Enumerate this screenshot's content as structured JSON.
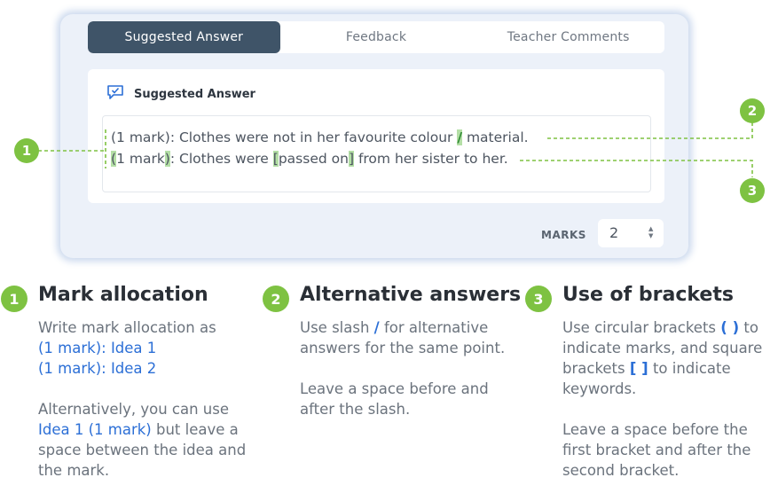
{
  "tabs": [
    {
      "label": "Suggested Answer",
      "active": true
    },
    {
      "label": "Feedback",
      "active": false
    },
    {
      "label": "Teacher Comments",
      "active": false
    }
  ],
  "panel": {
    "title": "Suggested Answer",
    "icon": "chat-check-icon",
    "line1": {
      "pre": "(1 mark): Clothes were not in her favourite colour ",
      "slash": "/",
      "post": " material."
    },
    "line2": {
      "open": "(",
      "a": "1 mark",
      "close": ")",
      "b": ": Clothes were ",
      "lb": "[",
      "kw": "passed on",
      "rb": "]",
      "c": " from her sister to her."
    }
  },
  "marks": {
    "label": "MARKS",
    "value": "2"
  },
  "callouts": [
    "1",
    "2",
    "3"
  ],
  "sections": [
    {
      "num": "1",
      "title": "Mark allocation",
      "p1a": "Write mark allocation as",
      "p1b": "(1 mark): Idea 1",
      "p1c": "(1 mark): Idea 2",
      "p2a": "Alternatively, you can use",
      "p2b": "Idea 1 (1 mark)",
      "p2c": " but leave a space between the idea and the mark."
    },
    {
      "num": "2",
      "title": "Alternative answers",
      "p1a": "Use slash ",
      "p1b": "/",
      "p1c": " for alternative answers for the same point.",
      "p2": "Leave a space before and after the slash."
    },
    {
      "num": "3",
      "title": "Use of brackets",
      "p1a": "Use circular brackets ",
      "p1b": "( )",
      "p1c": " to indicate marks, and square brackets ",
      "p1d": "[ ]",
      "p1e": " to indicate keywords.",
      "p2": "Leave a space before the first bracket and after the second bracket."
    }
  ],
  "colors": {
    "accent_green": "#7ec242",
    "active_tab": "#3f5468",
    "link_blue": "#2c6fd6",
    "highlight": "#b4dfa6"
  }
}
